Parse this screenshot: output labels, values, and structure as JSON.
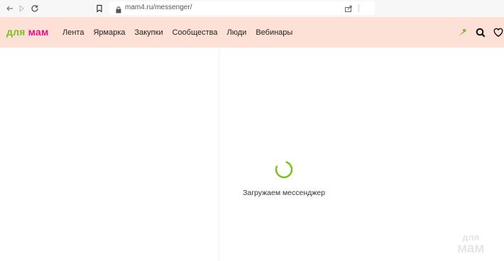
{
  "browser": {
    "url": "mam4.ru/messenger/",
    "icons": [
      "back-arrow-icon",
      "forward-arrow-icon",
      "reload-icon",
      "bookmark-icon",
      "lock-icon",
      "share-icon"
    ]
  },
  "header": {
    "logo_part1": "для",
    "logo_part2": "мам",
    "menu": [
      "Лента",
      "Ярмарка",
      "Закупки",
      "Сообщества",
      "Люди",
      "Вебинары"
    ],
    "icons": [
      "carrot-icon",
      "search-icon",
      "heart-icon"
    ],
    "colors": {
      "header_bg": "#fde0d6",
      "logo_green": "#7bc11d",
      "logo_pink": "#e2138c",
      "spinner_green": "#7bc11d"
    }
  },
  "main": {
    "loading_text": "Загружаем мессенджер",
    "watermark_line1": "для",
    "watermark_line2": "мам"
  }
}
